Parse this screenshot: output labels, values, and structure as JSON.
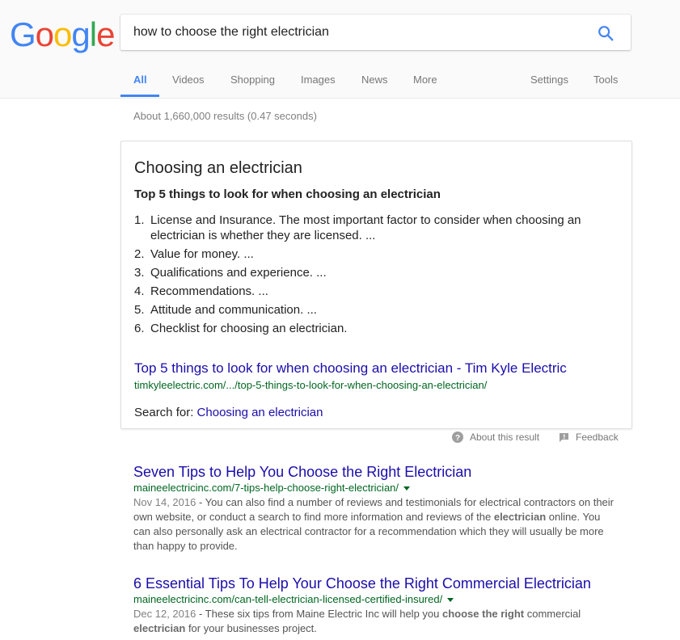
{
  "logo": {
    "letters": [
      "G",
      "o",
      "o",
      "g",
      "l",
      "e"
    ],
    "colors": [
      "#4285f4",
      "#ea4335",
      "#fbbc05",
      "#4285f4",
      "#34a853",
      "#ea4335"
    ]
  },
  "search": {
    "query": "how to choose the right electrician"
  },
  "tabs": [
    {
      "label": "All",
      "active": true
    },
    {
      "label": "Videos"
    },
    {
      "label": "Shopping"
    },
    {
      "label": "Images"
    },
    {
      "label": "News"
    },
    {
      "label": "More"
    }
  ],
  "tools": {
    "settings": "Settings",
    "tools": "Tools"
  },
  "stats": "About 1,660,000 results (0.47 seconds)",
  "featured": {
    "title": "Choosing an electrician",
    "subtitle": "Top 5 things to look for when choosing an electrician",
    "items": [
      {
        "num": "1.",
        "text": "License and Insurance. The most important factor to consider when choosing an electrician is whether they are licensed. ..."
      },
      {
        "num": "2.",
        "text": "Value for money. ..."
      },
      {
        "num": "3.",
        "text": "Qualifications and experience. ..."
      },
      {
        "num": "4.",
        "text": "Recommendations. ..."
      },
      {
        "num": "5.",
        "text": "Attitude and communication. ..."
      },
      {
        "num": "6.",
        "text": "Checklist for choosing an electrician."
      }
    ],
    "link_title": "Top 5 things to look for when choosing an electrician - Tim Kyle Electric",
    "link_url": "timkyleelectric.com/.../top-5-things-to-look-for-when-choosing-an-electrician/",
    "search_for_label": "Search for:",
    "search_for_link": "Choosing an electrician"
  },
  "meta": {
    "about": "About this result",
    "feedback": "Feedback"
  },
  "results": [
    {
      "title": "Seven Tips to Help You Choose the Right Electrician",
      "url": "maineelectricinc.com/7-tips-help-choose-right-electrician/",
      "date": "Nov 14, 2016",
      "snippet_a": " - You can also find a number of reviews and testimonials for electrical contractors on their own website, or conduct a search to find more information and reviews of the ",
      "snippet_bold": "electrician",
      "snippet_b": " online. You can also personally ask an electrical contractor for a recommendation which they will usually be more than happy to provide."
    },
    {
      "title": "6 Essential Tips To Help Your Choose the Right Commercial Electrician",
      "url": "maineelectricinc.com/can-tell-electrician-licensed-certified-insured/",
      "date": "Dec 12, 2016",
      "snippet_a": " - These six tips from Maine Electric Inc will help you ",
      "snippet_bold": "choose the right",
      "snippet_b": " commercial ",
      "snippet_bold2": "electrician",
      "snippet_c": " for your businesses project."
    }
  ]
}
